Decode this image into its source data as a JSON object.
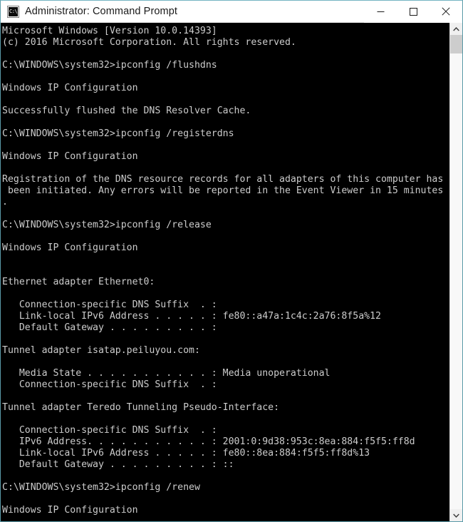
{
  "window": {
    "title": "Administrator: Command Prompt",
    "icon": "console-icon",
    "icon_glyph": "C:\\",
    "background_color": "#000000",
    "text_color": "#cccccc",
    "border_color": "#5a9aa8"
  },
  "titlebar": {
    "minimize_label": "Minimize",
    "maximize_label": "Maximize",
    "close_label": "Close"
  },
  "scrollbar": {
    "up_label": "Scroll up",
    "down_label": "Scroll down",
    "thumb_label": "Scroll thumb"
  },
  "console": {
    "lines": [
      "Microsoft Windows [Version 10.0.14393]",
      "(c) 2016 Microsoft Corporation. All rights reserved.",
      "",
      "C:\\WINDOWS\\system32>ipconfig /flushdns",
      "",
      "Windows IP Configuration",
      "",
      "Successfully flushed the DNS Resolver Cache.",
      "",
      "C:\\WINDOWS\\system32>ipconfig /registerdns",
      "",
      "Windows IP Configuration",
      "",
      "Registration of the DNS resource records for all adapters of this computer has",
      " been initiated. Any errors will be reported in the Event Viewer in 15 minutes",
      ".",
      "",
      "C:\\WINDOWS\\system32>ipconfig /release",
      "",
      "Windows IP Configuration",
      "",
      "",
      "Ethernet adapter Ethernet0:",
      "",
      "   Connection-specific DNS Suffix  . :",
      "   Link-local IPv6 Address . . . . . : fe80::a47a:1c4c:2a76:8f5a%12",
      "   Default Gateway . . . . . . . . . :",
      "",
      "Tunnel adapter isatap.peiluyou.com:",
      "",
      "   Media State . . . . . . . . . . . : Media unoperational",
      "   Connection-specific DNS Suffix  . :",
      "",
      "Tunnel adapter Teredo Tunneling Pseudo-Interface:",
      "",
      "   Connection-specific DNS Suffix  . :",
      "   IPv6 Address. . . . . . . . . . . : 2001:0:9d38:953c:8ea:884:f5f5:ff8d",
      "   Link-local IPv6 Address . . . . . : fe80::8ea:884:f5f5:ff8d%13",
      "   Default Gateway . . . . . . . . . : ::",
      "",
      "C:\\WINDOWS\\system32>ipconfig /renew",
      "",
      "Windows IP Configuration"
    ]
  }
}
